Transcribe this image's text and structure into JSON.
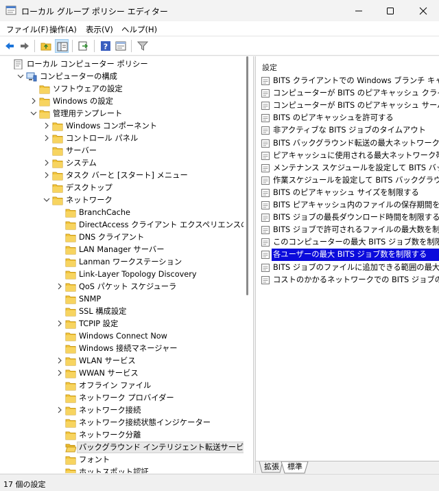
{
  "window": {
    "title": "ローカル グループ ポリシー エディター"
  },
  "menu": [
    "ファイル(F)",
    "操作(A)",
    "表示(V)",
    "ヘルプ(H)"
  ],
  "toolbar": {
    "buttons": [
      "back-icon",
      "forward-icon",
      "up-folder-icon",
      "show-hide-tree-icon",
      "export-list-icon",
      "help-icon",
      "properties-icon",
      "filter-icon"
    ]
  },
  "tree": [
    {
      "label": "ローカル コンピューター ポリシー",
      "indent": 0,
      "icon": "policy",
      "chev": "none"
    },
    {
      "label": "コンピューターの構成",
      "indent": 1,
      "icon": "computer",
      "chev": "down"
    },
    {
      "label": "ソフトウェアの設定",
      "indent": 2,
      "icon": "folder",
      "chev": "none"
    },
    {
      "label": "Windows の設定",
      "indent": 2,
      "icon": "folder",
      "chev": "right"
    },
    {
      "label": "管理用テンプレート",
      "indent": 2,
      "icon": "folder",
      "chev": "down"
    },
    {
      "label": "Windows コンポーネント",
      "indent": 3,
      "icon": "folder",
      "chev": "right"
    },
    {
      "label": "コントロール パネル",
      "indent": 3,
      "icon": "folder",
      "chev": "right"
    },
    {
      "label": "サーバー",
      "indent": 3,
      "icon": "folder",
      "chev": "none"
    },
    {
      "label": "システム",
      "indent": 3,
      "icon": "folder",
      "chev": "right"
    },
    {
      "label": "タスク バーと [スタート] メニュー",
      "indent": 3,
      "icon": "folder",
      "chev": "right"
    },
    {
      "label": "デスクトップ",
      "indent": 3,
      "icon": "folder",
      "chev": "none"
    },
    {
      "label": "ネットワーク",
      "indent": 3,
      "icon": "folder",
      "chev": "down"
    },
    {
      "label": "BranchCache",
      "indent": 4,
      "icon": "folder",
      "chev": "none"
    },
    {
      "label": "DirectAccess クライアント エクスペリエンスの設定",
      "indent": 4,
      "icon": "folder",
      "chev": "none"
    },
    {
      "label": "DNS クライアント",
      "indent": 4,
      "icon": "folder",
      "chev": "none"
    },
    {
      "label": "LAN Manager サーバー",
      "indent": 4,
      "icon": "folder",
      "chev": "none"
    },
    {
      "label": "Lanman ワークステーション",
      "indent": 4,
      "icon": "folder",
      "chev": "none"
    },
    {
      "label": "Link-Layer Topology Discovery",
      "indent": 4,
      "icon": "folder",
      "chev": "none"
    },
    {
      "label": "QoS パケット スケジューラ",
      "indent": 4,
      "icon": "folder",
      "chev": "right"
    },
    {
      "label": "SNMP",
      "indent": 4,
      "icon": "folder",
      "chev": "none"
    },
    {
      "label": "SSL 構成設定",
      "indent": 4,
      "icon": "folder",
      "chev": "none"
    },
    {
      "label": "TCPIP 設定",
      "indent": 4,
      "icon": "folder",
      "chev": "right"
    },
    {
      "label": "Windows Connect Now",
      "indent": 4,
      "icon": "folder",
      "chev": "none"
    },
    {
      "label": "Windows 接続マネージャー",
      "indent": 4,
      "icon": "folder",
      "chev": "none"
    },
    {
      "label": "WLAN サービス",
      "indent": 4,
      "icon": "folder",
      "chev": "right"
    },
    {
      "label": "WWAN サービス",
      "indent": 4,
      "icon": "folder",
      "chev": "right"
    },
    {
      "label": "オフライン ファイル",
      "indent": 4,
      "icon": "folder",
      "chev": "none"
    },
    {
      "label": "ネットワーク プロバイダー",
      "indent": 4,
      "icon": "folder",
      "chev": "none"
    },
    {
      "label": "ネットワーク接続",
      "indent": 4,
      "icon": "folder",
      "chev": "right"
    },
    {
      "label": "ネットワーク接続状態インジケーター",
      "indent": 4,
      "icon": "folder",
      "chev": "none"
    },
    {
      "label": "ネットワーク分離",
      "indent": 4,
      "icon": "folder",
      "chev": "none"
    },
    {
      "label": "バックグラウンド インテリジェント転送サービス (BITS)",
      "indent": 4,
      "icon": "folder-open",
      "chev": "none",
      "selected": true
    },
    {
      "label": "フォント",
      "indent": 4,
      "icon": "folder",
      "chev": "none"
    },
    {
      "label": "ホットスポット認証",
      "indent": 4,
      "icon": "folder",
      "chev": "none"
    }
  ],
  "settings_panel": {
    "header": "設定",
    "items": [
      "BITS クライアントでの Windows ブランチ キャッシュの使用を許可する",
      "コンピューターが BITS のピアキャッシュ クライアントとして動作することを許可しない",
      "コンピューターが BITS のピアキャッシュ サーバーとして動作することを許可しない",
      "BITS のピアキャッシュを許可する",
      "非アクティブな BITS ジョブのタイムアウト",
      "BITS バックグラウンド転送の最大ネットワーク帯域幅を制限する",
      "ピアキャッシュに使用される最大ネットワーク帯域幅を制限する",
      "メンテナンス スケジュールを設定して BITS バックグラウンド転送を制限する",
      "作業スケジュールを設定して BITS バックグラウンド転送を制限する",
      "BITS のピアキャッシュ サイズを制限する",
      "BITS ピアキャッシュ内のファイルの保存期間を制限する",
      "BITS ジョブの最長ダウンロード時間を制限する",
      "BITS ジョブで許可されるファイルの最大数を制限する",
      "このコンピューターの最大 BITS ジョブ数を制限する",
      "各ユーザーの最大 BITS ジョブ数を制限する",
      "BITS ジョブのファイルに追加できる範囲の最大値を制限する",
      "コストのかかるネットワークでの BITS ジョブの既定のダウンロード動作を設定する"
    ],
    "selected_index": 14
  },
  "tabs": [
    "拡張",
    "標準"
  ],
  "status": {
    "text": "17 個の設定"
  },
  "colors": {
    "selection": "#0b0bdc",
    "folder": "#f3c63d",
    "accent": "#1a73d9"
  }
}
